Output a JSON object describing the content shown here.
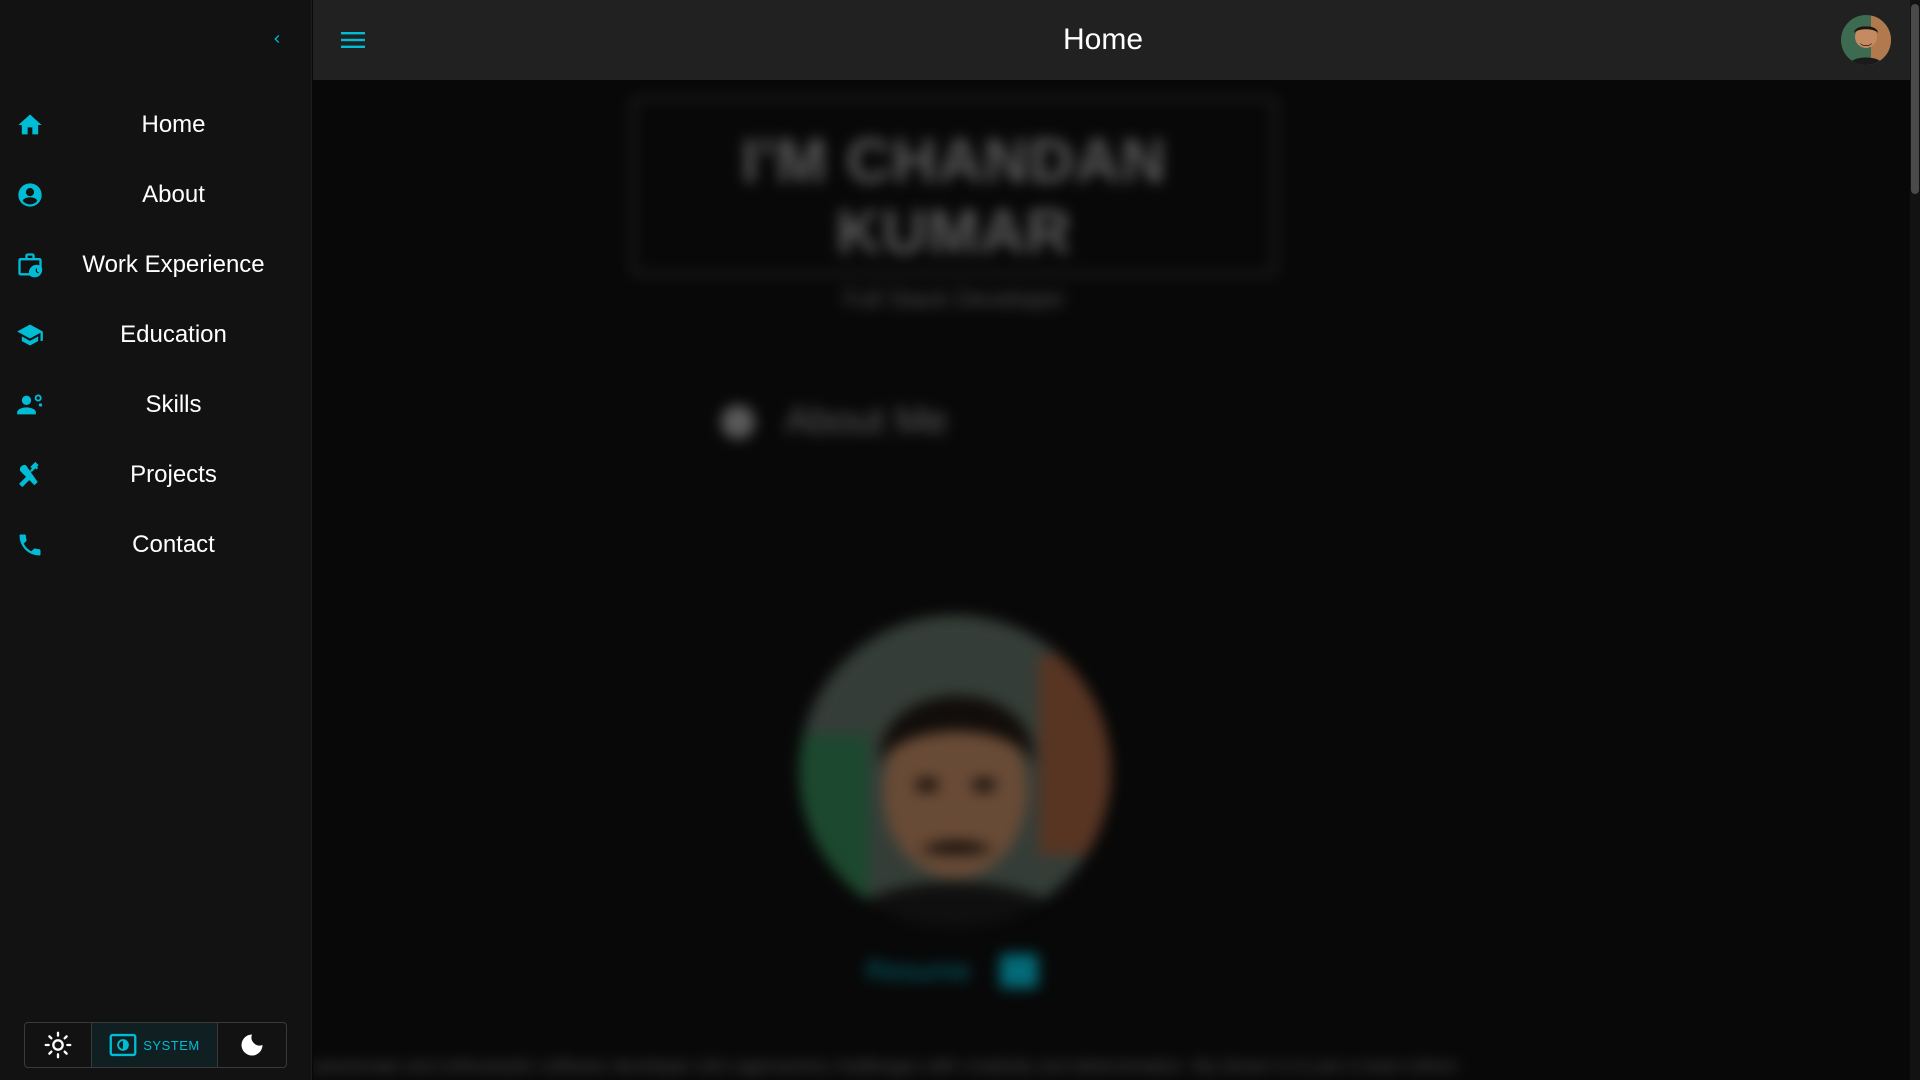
{
  "header": {
    "title": "Home"
  },
  "sidebar": {
    "items": [
      {
        "label": "Home",
        "icon": "home-icon"
      },
      {
        "label": "About",
        "icon": "account-circle-icon"
      },
      {
        "label": "Work Experience",
        "icon": "work-history-icon"
      },
      {
        "label": "Education",
        "icon": "school-icon"
      },
      {
        "label": "Skills",
        "icon": "engineering-icon"
      },
      {
        "label": "Projects",
        "icon": "build-icon"
      },
      {
        "label": "Contact",
        "icon": "phone-icon"
      }
    ],
    "theme": {
      "system_label": "SYSTEM",
      "selected": "system"
    }
  },
  "main": {
    "hero_name": "I'M CHANDAN KUMAR",
    "hero_role": "Full Stack Developer",
    "about_title": "About Me",
    "resume_label": "Resume",
    "bio_text": "passionate and enthusiastic software developer who approaches challenges with creativity and determination. My dream is to join a team where"
  },
  "colors": {
    "accent": "#00bcd4",
    "sidebar_bg": "#121212",
    "header_bg": "#212121",
    "content_bg": "#080808"
  }
}
